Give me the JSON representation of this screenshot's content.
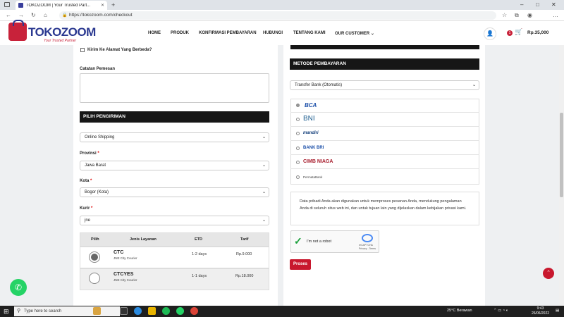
{
  "browser": {
    "tab_title": "TOKOZOOM | Your Trusted Part...",
    "url": "https://tokozoom.com/checkout"
  },
  "header": {
    "logo": "TOKOZOOM",
    "tagline": "Your Trusted Partner",
    "menu": [
      "HOME",
      "PRODUK",
      "KONFIRMASI PEMBAYARAN",
      "HUBUNGI",
      "TENTANG KAMI",
      "OUR CUSTOMER"
    ],
    "cart_count": "1",
    "cart_total": "Rp.35,000"
  },
  "left": {
    "ship_diff_label": "Kirim Ke Alamat Yang Berbeda?",
    "notes_label": "Catatan Pemesan",
    "section_title": "PILIH PENGIRIMAN",
    "shipping_method": "Online Shipping",
    "provinsi_label": "Provinsi",
    "provinsi_value": "Jawa Barat",
    "kota_label": "Kota",
    "kota_value": "Bogor (Kota)",
    "kurir_label": "Kurir",
    "kurir_value": "jne",
    "table_headers": [
      "Pilih",
      "Jenis Layanan",
      "ETD",
      "Tarif"
    ],
    "rows": [
      {
        "service": "CTC",
        "sub": "JNE City Courier",
        "etd": "1-2 days",
        "tarif": "Rp.9.000",
        "selected": true
      },
      {
        "service": "CTCYES",
        "sub": "JNE City Courier",
        "etd": "1-1 days",
        "tarif": "Rp.18.000",
        "selected": false
      }
    ]
  },
  "right": {
    "section_title": "METODE PEMBAYARAN",
    "payment_method": "Transfer Bank (Otomatis)",
    "banks": [
      "BCA",
      "BNI",
      "mandiri",
      "BANK BRI",
      "CIMB NIAGA",
      "PermataBank"
    ],
    "privacy_note": "Data pribadi Anda akan digunakan untuk memproses pesanan Anda, mendukung pengalaman Anda di seluruh situs web ini, dan untuk tujuan lain yang dijelaskan dalam kebijakan privasi kami.",
    "recaptcha_label": "I'm not a robot",
    "recaptcha_sub": "reCAPTCHA",
    "recaptcha_terms": "Privacy - Terms",
    "submit_label": "Proses"
  },
  "taskbar": {
    "search_placeholder": "Type here to search",
    "weather": "25°C  Berawan",
    "time": "9:43",
    "date": "26/06/2022"
  }
}
